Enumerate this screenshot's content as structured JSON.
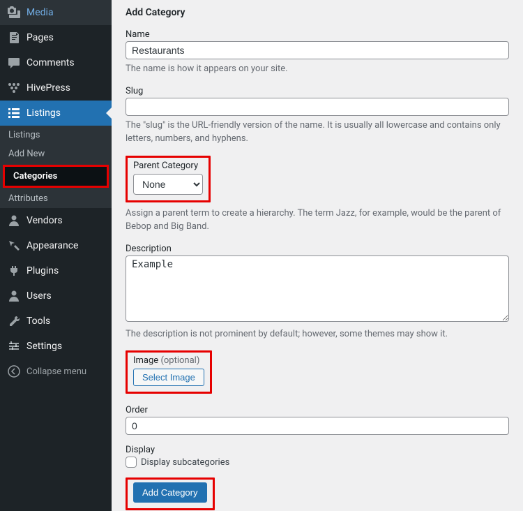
{
  "sidebar": {
    "items": [
      {
        "label": "Media",
        "icon": "media"
      },
      {
        "label": "Pages",
        "icon": "pages"
      },
      {
        "label": "Comments",
        "icon": "comments"
      },
      {
        "label": "HivePress",
        "icon": "hivepress"
      },
      {
        "label": "Listings",
        "icon": "listings",
        "active": true,
        "submenu": [
          {
            "label": "Listings"
          },
          {
            "label": "Add New"
          },
          {
            "label": "Categories",
            "current": true
          },
          {
            "label": "Attributes"
          }
        ]
      },
      {
        "label": "Vendors",
        "icon": "vendors"
      },
      {
        "label": "Appearance",
        "icon": "appearance"
      },
      {
        "label": "Plugins",
        "icon": "plugins"
      },
      {
        "label": "Users",
        "icon": "users"
      },
      {
        "label": "Tools",
        "icon": "tools"
      },
      {
        "label": "Settings",
        "icon": "settings"
      }
    ],
    "collapse": "Collapse menu"
  },
  "page": {
    "title": "Add Category",
    "name": {
      "label": "Name",
      "value": "Restaurants",
      "help": "The name is how it appears on your site."
    },
    "slug": {
      "label": "Slug",
      "value": "",
      "help": "The \"slug\" is the URL-friendly version of the name. It is usually all lowercase and contains only letters, numbers, and hyphens."
    },
    "parent": {
      "label": "Parent Category",
      "value": "None",
      "help": "Assign a parent term to create a hierarchy. The term Jazz, for example, would be the parent of Bebop and Big Band."
    },
    "description": {
      "label": "Description",
      "value": "Example",
      "help": "The description is not prominent by default; however, some themes may show it."
    },
    "image": {
      "label": "Image",
      "optional": "(optional)",
      "button": "Select Image"
    },
    "order": {
      "label": "Order",
      "value": "0"
    },
    "display": {
      "label": "Display",
      "checkbox": "Display subcategories"
    },
    "submit": "Add Category"
  }
}
